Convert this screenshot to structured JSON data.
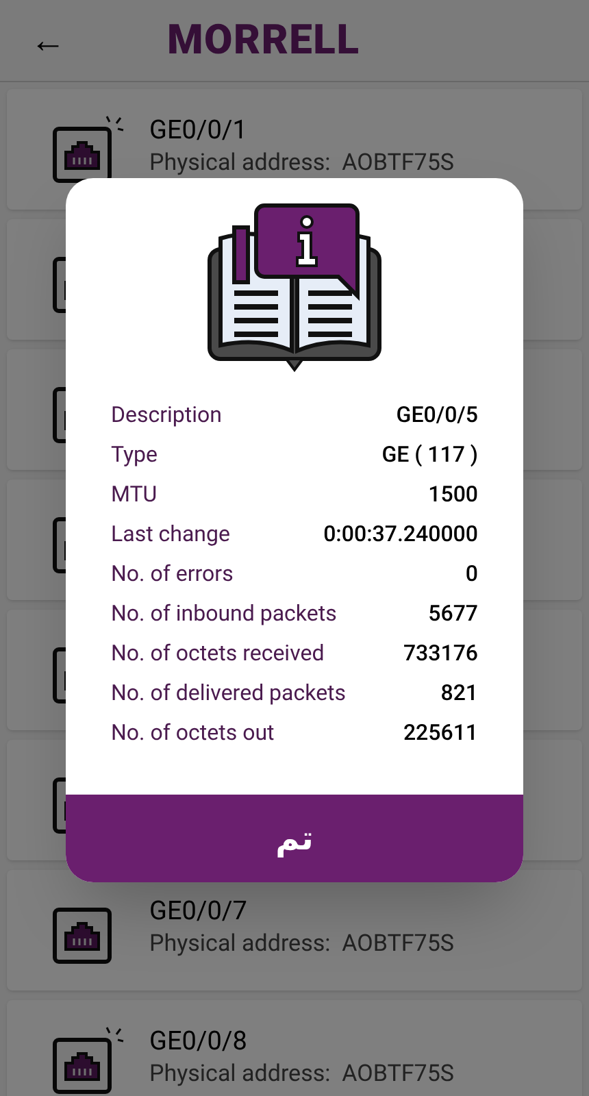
{
  "header": {
    "back": "←",
    "logo": "MORRELL"
  },
  "ports": [
    {
      "kind": "port",
      "name": "GE0/0/1",
      "address": "Physical address:  AOBTF75S",
      "blinking": true
    },
    {
      "kind": "covered"
    },
    {
      "kind": "covered"
    },
    {
      "kind": "covered"
    },
    {
      "kind": "covered"
    },
    {
      "kind": "covered"
    },
    {
      "kind": "port",
      "name": "GE0/0/7",
      "address": "Physical address:  AOBTF75S",
      "blinking": false
    },
    {
      "kind": "port",
      "name": "GE0/0/8",
      "address": "Physical address:  AOBTF75S",
      "blinking": true
    }
  ],
  "dialog": {
    "rows": [
      {
        "label": "Description",
        "value": "GE0/0/5"
      },
      {
        "label": "Type",
        "value": "GE ( 117 )"
      },
      {
        "label": "MTU",
        "value": "1500"
      },
      {
        "label": "Last change",
        "value": "0:00:37.240000"
      },
      {
        "label": "No. of errors",
        "value": "0"
      },
      {
        "label": "No. of inbound packets",
        "value": "5677"
      },
      {
        "label": "No. of octets received",
        "value": "733176"
      },
      {
        "label": "No. of delivered packets",
        "value": "821"
      },
      {
        "label": "No. of octets out",
        "value": "225611"
      }
    ],
    "button": "تم"
  }
}
